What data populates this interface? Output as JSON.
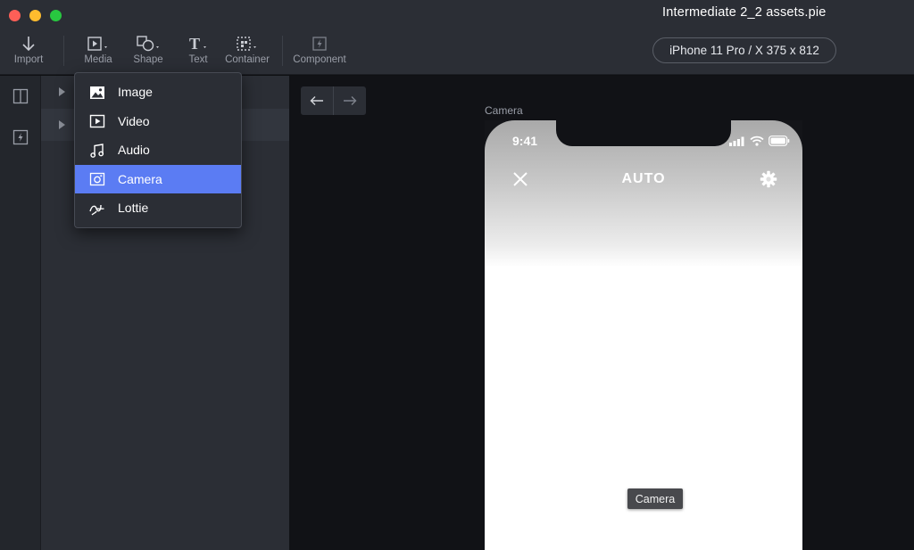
{
  "window": {
    "title": "Intermediate 2_2 assets.pie"
  },
  "toolbar": {
    "import_label": "Import",
    "media_label": "Media",
    "shape_label": "Shape",
    "text_label": "Text",
    "container_label": "Container",
    "component_label": "Component"
  },
  "device": {
    "label": "iPhone 11 Pro / X  375 x 812"
  },
  "media_menu": {
    "items": [
      {
        "label": "Image",
        "icon": "image-icon"
      },
      {
        "label": "Video",
        "icon": "video-icon"
      },
      {
        "label": "Audio",
        "icon": "audio-icon"
      },
      {
        "label": "Camera",
        "icon": "camera-icon",
        "selected": true
      },
      {
        "label": "Lottie",
        "icon": "lottie-icon"
      }
    ]
  },
  "canvas": {
    "frame_label": "Camera",
    "status_time": "9:41",
    "camera_mode": "AUTO",
    "tooltip": "Camera"
  },
  "colors": {
    "accent": "#5b7cf3",
    "toolbar_bg": "#2b2e35",
    "canvas_bg": "#111216"
  }
}
